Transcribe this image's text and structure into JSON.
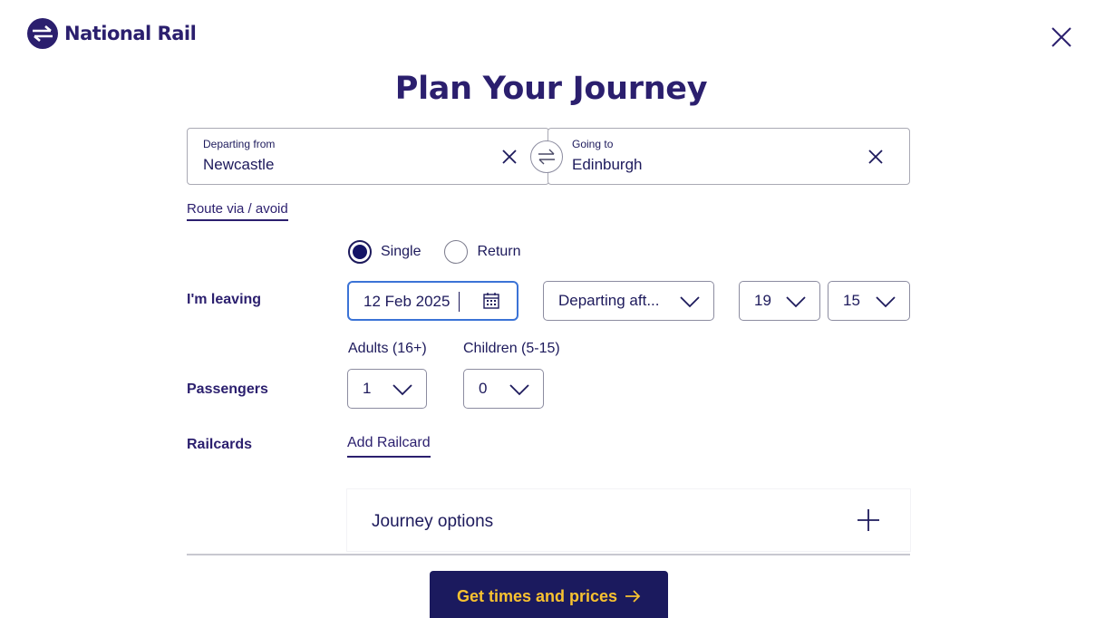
{
  "header": {
    "brand": "National Rail",
    "title": "Plan Your Journey"
  },
  "stations": {
    "from_label": "Departing from",
    "from_value": "Newcastle",
    "to_label": "Going to",
    "to_value": "Edinburgh"
  },
  "route_link": "Route via / avoid",
  "journey_type": {
    "options": [
      "Single",
      "Return"
    ],
    "selected": "Single"
  },
  "leaving": {
    "label": "I'm leaving",
    "date": "12 Feb 2025",
    "time_mode": "Departing aft...",
    "hour": "19",
    "minute": "15"
  },
  "passengers": {
    "label": "Passengers",
    "adults_label": "Adults (16+)",
    "adults_value": "1",
    "children_label": "Children (5-15)",
    "children_value": "0"
  },
  "railcards": {
    "label": "Railcards",
    "link": "Add Railcard"
  },
  "journey_options_label": "Journey options",
  "cta_label": "Get times and prices",
  "colors": {
    "brand_navy": "#2b1f6e",
    "cta_bg": "#1b1a5e",
    "cta_text": "#f8c230",
    "focus_blue": "#3b73d6"
  }
}
